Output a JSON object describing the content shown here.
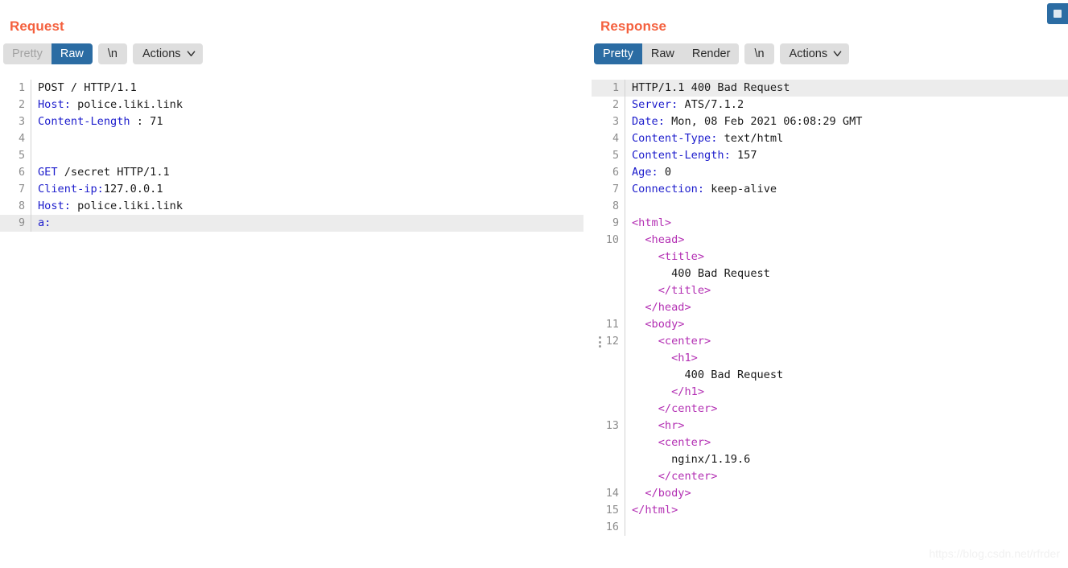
{
  "request": {
    "title": "Request",
    "tabs": [
      {
        "label": "Pretty",
        "state": "disabled"
      },
      {
        "label": "Raw",
        "state": "active"
      }
    ],
    "newline_button": "\\n",
    "actions_button": "Actions",
    "lines": [
      {
        "num": "1",
        "highlight": false,
        "indent": 0,
        "spans": [
          {
            "text": "POST / HTTP/1.1",
            "tok": "txt"
          }
        ]
      },
      {
        "num": "2",
        "highlight": false,
        "indent": 0,
        "spans": [
          {
            "text": "Host:",
            "tok": "hdr"
          },
          {
            "text": " police.liki.link",
            "tok": "txt"
          }
        ]
      },
      {
        "num": "3",
        "highlight": false,
        "indent": 0,
        "spans": [
          {
            "text": "Content-Length",
            "tok": "hdr"
          },
          {
            "text": " : 71",
            "tok": "txt"
          }
        ]
      },
      {
        "num": "4",
        "highlight": false,
        "indent": 0,
        "spans": []
      },
      {
        "num": "5",
        "highlight": false,
        "indent": 0,
        "spans": []
      },
      {
        "num": "6",
        "highlight": false,
        "indent": 0,
        "spans": [
          {
            "text": "GET",
            "tok": "kw"
          },
          {
            "text": " /secret HTTP/1.1",
            "tok": "txt"
          }
        ]
      },
      {
        "num": "7",
        "highlight": false,
        "indent": 0,
        "spans": [
          {
            "text": "Client-ip:",
            "tok": "hdr"
          },
          {
            "text": "127.0.0.1",
            "tok": "txt"
          }
        ]
      },
      {
        "num": "8",
        "highlight": false,
        "indent": 0,
        "spans": [
          {
            "text": "Host:",
            "tok": "hdr"
          },
          {
            "text": " police.liki.link",
            "tok": "txt"
          }
        ]
      },
      {
        "num": "9",
        "highlight": true,
        "indent": 0,
        "spans": [
          {
            "text": "a:",
            "tok": "hdr"
          }
        ]
      }
    ]
  },
  "response": {
    "title": "Response",
    "tabs": [
      {
        "label": "Pretty",
        "state": "active"
      },
      {
        "label": "Raw",
        "state": "normal"
      },
      {
        "label": "Render",
        "state": "normal"
      }
    ],
    "newline_button": "\\n",
    "actions_button": "Actions",
    "lines": [
      {
        "num": "1",
        "highlight": true,
        "handle": false,
        "spans": [
          {
            "text": "HTTP/1.1 400 Bad Request",
            "tok": "txt"
          }
        ]
      },
      {
        "num": "2",
        "highlight": false,
        "handle": false,
        "spans": [
          {
            "text": "Server:",
            "tok": "hdr"
          },
          {
            "text": " ATS/7.1.2",
            "tok": "txt"
          }
        ]
      },
      {
        "num": "3",
        "highlight": false,
        "handle": false,
        "spans": [
          {
            "text": "Date:",
            "tok": "hdr"
          },
          {
            "text": " Mon, 08 Feb 2021 06:08:29 GMT",
            "tok": "txt"
          }
        ]
      },
      {
        "num": "4",
        "highlight": false,
        "handle": false,
        "spans": [
          {
            "text": "Content-Type:",
            "tok": "hdr"
          },
          {
            "text": " text/html",
            "tok": "txt"
          }
        ]
      },
      {
        "num": "5",
        "highlight": false,
        "handle": false,
        "spans": [
          {
            "text": "Content-Length:",
            "tok": "hdr"
          },
          {
            "text": " 157",
            "tok": "txt"
          }
        ]
      },
      {
        "num": "6",
        "highlight": false,
        "handle": false,
        "spans": [
          {
            "text": "Age:",
            "tok": "hdr"
          },
          {
            "text": " 0",
            "tok": "txt"
          }
        ]
      },
      {
        "num": "7",
        "highlight": false,
        "handle": false,
        "spans": [
          {
            "text": "Connection:",
            "tok": "hdr"
          },
          {
            "text": " keep-alive",
            "tok": "txt"
          }
        ]
      },
      {
        "num": "8",
        "highlight": false,
        "handle": false,
        "spans": []
      },
      {
        "num": "9",
        "highlight": false,
        "handle": false,
        "spans": [
          {
            "text": "<html>",
            "tok": "tag"
          }
        ]
      },
      {
        "num": "10",
        "highlight": false,
        "handle": false,
        "spans": [
          {
            "text": "  <head>",
            "tok": "tag"
          }
        ]
      },
      {
        "num": "",
        "highlight": false,
        "handle": false,
        "spans": [
          {
            "text": "    <title>",
            "tok": "tag"
          }
        ]
      },
      {
        "num": "",
        "highlight": false,
        "handle": false,
        "spans": [
          {
            "text": "      400 Bad Request",
            "tok": "txt"
          }
        ]
      },
      {
        "num": "",
        "highlight": false,
        "handle": false,
        "spans": [
          {
            "text": "    </title>",
            "tok": "tag"
          }
        ]
      },
      {
        "num": "",
        "highlight": false,
        "handle": false,
        "spans": [
          {
            "text": "  </head>",
            "tok": "tag"
          }
        ]
      },
      {
        "num": "11",
        "highlight": false,
        "handle": false,
        "spans": [
          {
            "text": "  <body>",
            "tok": "tag"
          }
        ]
      },
      {
        "num": "12",
        "highlight": false,
        "handle": true,
        "spans": [
          {
            "text": "    <center>",
            "tok": "tag"
          }
        ]
      },
      {
        "num": "",
        "highlight": false,
        "handle": false,
        "spans": [
          {
            "text": "      <h1>",
            "tok": "tag"
          }
        ]
      },
      {
        "num": "",
        "highlight": false,
        "handle": false,
        "spans": [
          {
            "text": "        400 Bad Request",
            "tok": "txt"
          }
        ]
      },
      {
        "num": "",
        "highlight": false,
        "handle": false,
        "spans": [
          {
            "text": "      </h1>",
            "tok": "tag"
          }
        ]
      },
      {
        "num": "",
        "highlight": false,
        "handle": false,
        "spans": [
          {
            "text": "    </center>",
            "tok": "tag"
          }
        ]
      },
      {
        "num": "13",
        "highlight": false,
        "handle": false,
        "spans": [
          {
            "text": "    <hr>",
            "tok": "tag"
          }
        ]
      },
      {
        "num": "",
        "highlight": false,
        "handle": false,
        "spans": [
          {
            "text": "    <center>",
            "tok": "tag"
          }
        ]
      },
      {
        "num": "",
        "highlight": false,
        "handle": false,
        "spans": [
          {
            "text": "      nginx/1.19.6",
            "tok": "txt"
          }
        ]
      },
      {
        "num": "",
        "highlight": false,
        "handle": false,
        "spans": [
          {
            "text": "    </center>",
            "tok": "tag"
          }
        ]
      },
      {
        "num": "14",
        "highlight": false,
        "handle": false,
        "spans": [
          {
            "text": "  </body>",
            "tok": "tag"
          }
        ]
      },
      {
        "num": "15",
        "highlight": false,
        "handle": false,
        "spans": [
          {
            "text": "</html>",
            "tok": "tag"
          }
        ]
      },
      {
        "num": "16",
        "highlight": false,
        "handle": false,
        "spans": []
      }
    ]
  },
  "watermark": "https://blog.csdn.net/rfrder",
  "colors": {
    "title": "#f4603e",
    "tab_active": "#2b6ca3",
    "tab_bg": "#dedede",
    "header_token": "#1c1ccc",
    "tag_token": "#b32fb3",
    "line_highlight": "#ececec"
  }
}
